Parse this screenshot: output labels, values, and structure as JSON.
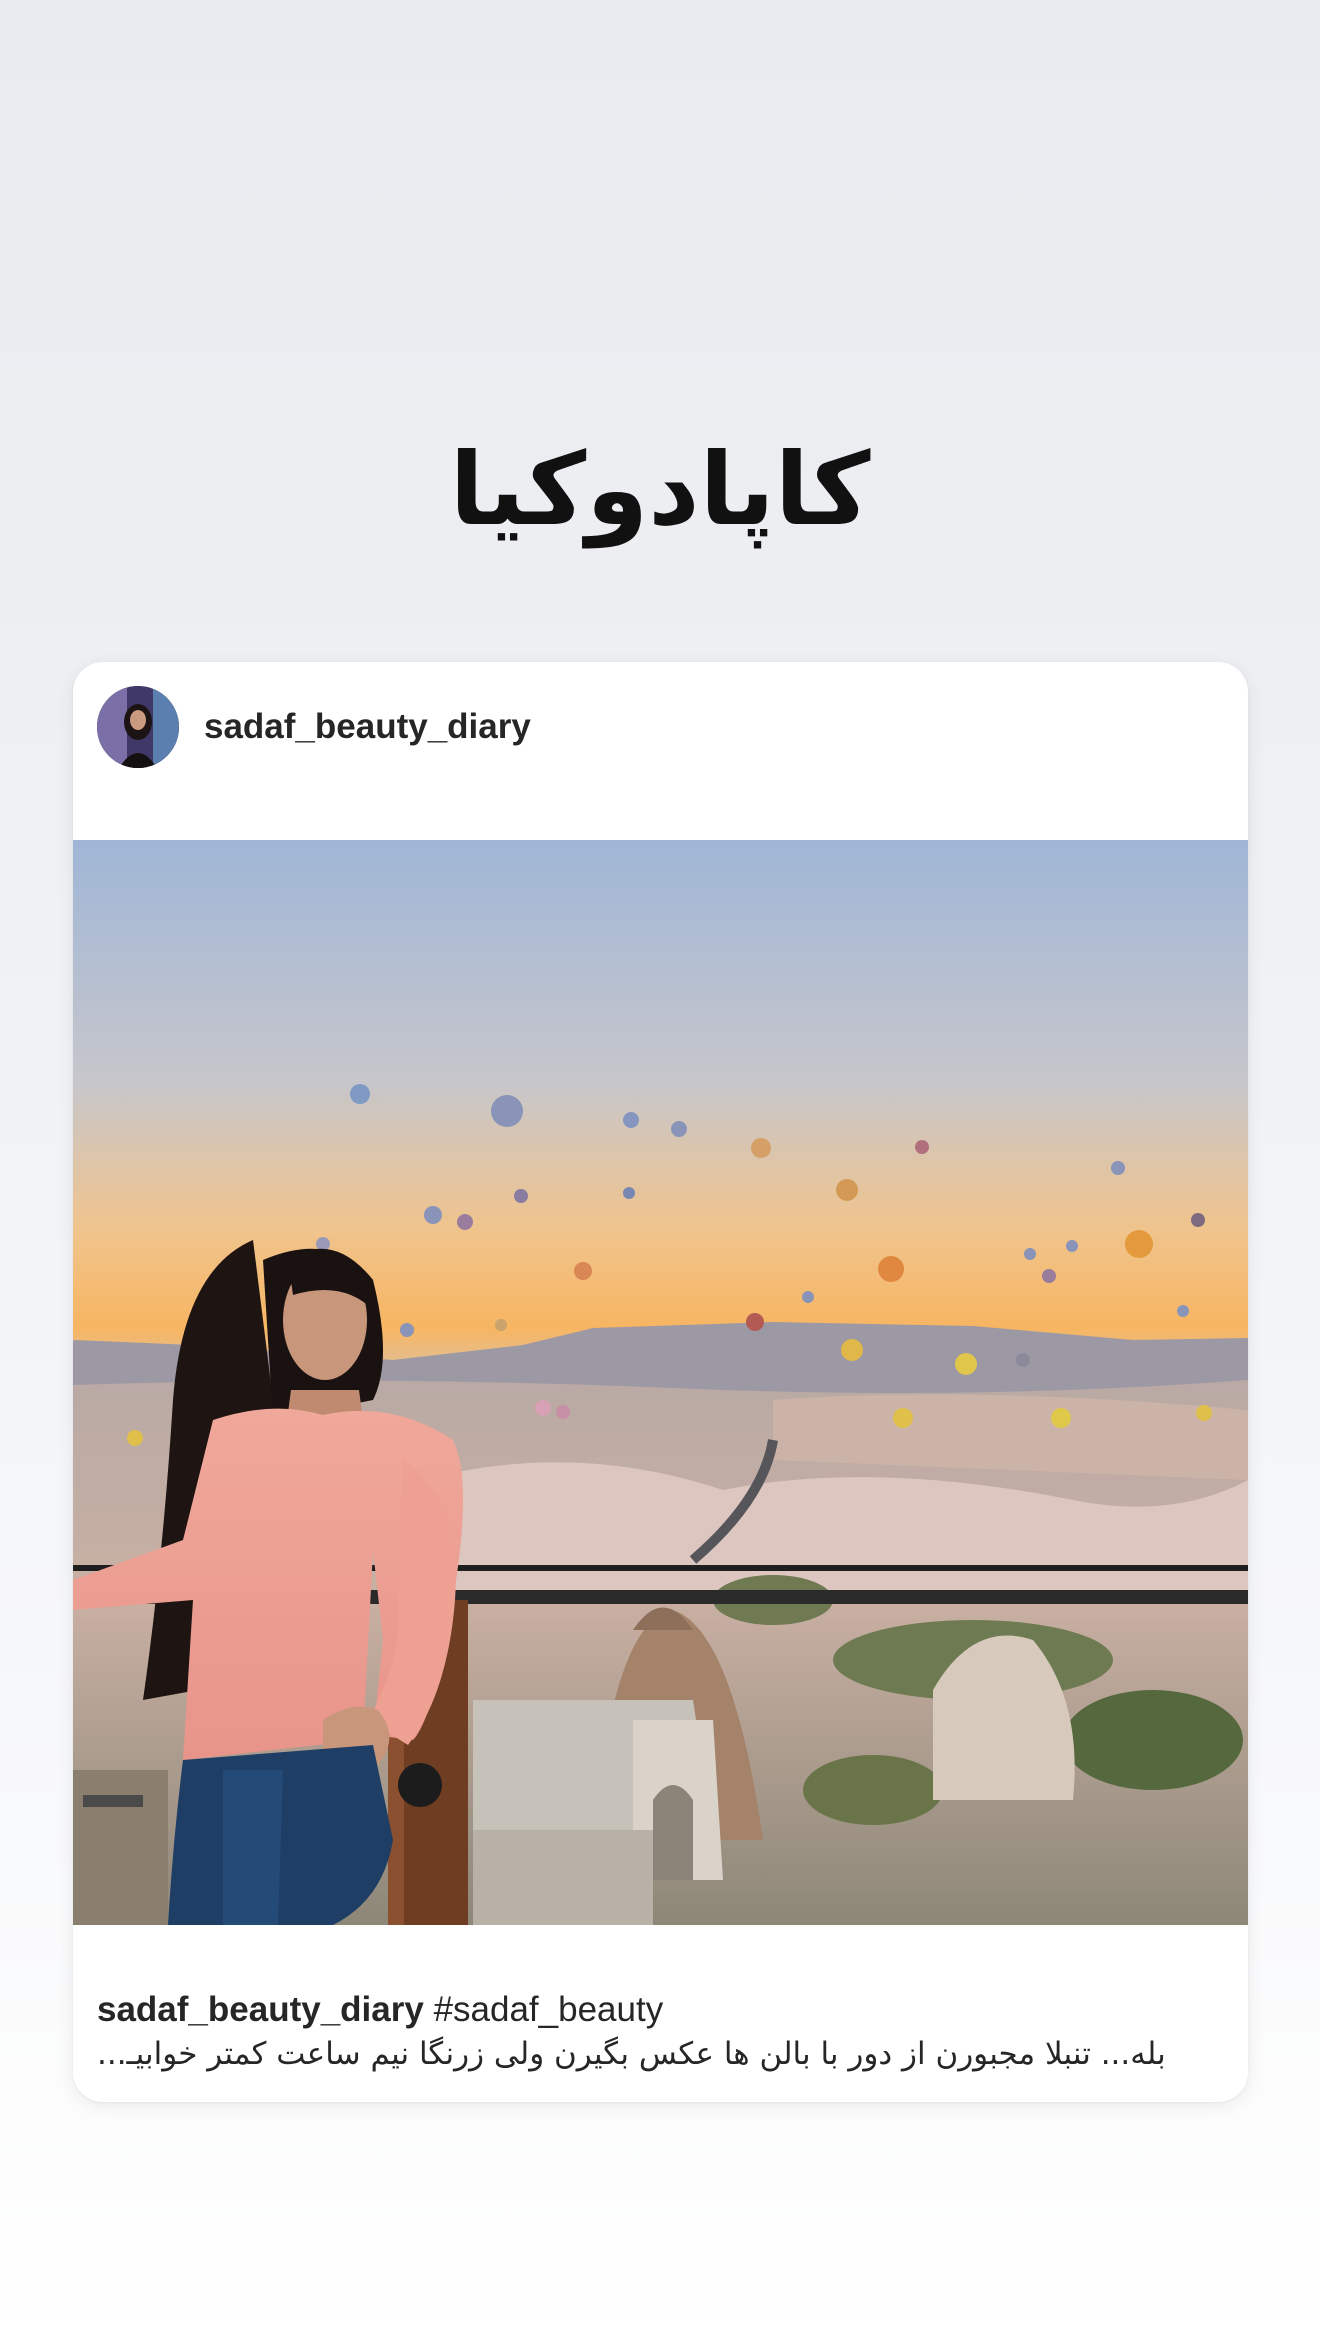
{
  "story": {
    "title": "کاپادوکیا"
  },
  "post": {
    "username": "sadaf_beauty_diary",
    "caption_username": "sadaf_beauty_diary",
    "hashtag": "#sadaf_beauty",
    "caption_text": "بله... تنبلا مجبورن از دور با بالن ها عکس بگیرن ولی زرنگا نیم ساعت کمتر خوابیـ..."
  },
  "colors": {
    "background_top": "#e8ebef",
    "card": "#ffffff",
    "text": "#262626"
  }
}
